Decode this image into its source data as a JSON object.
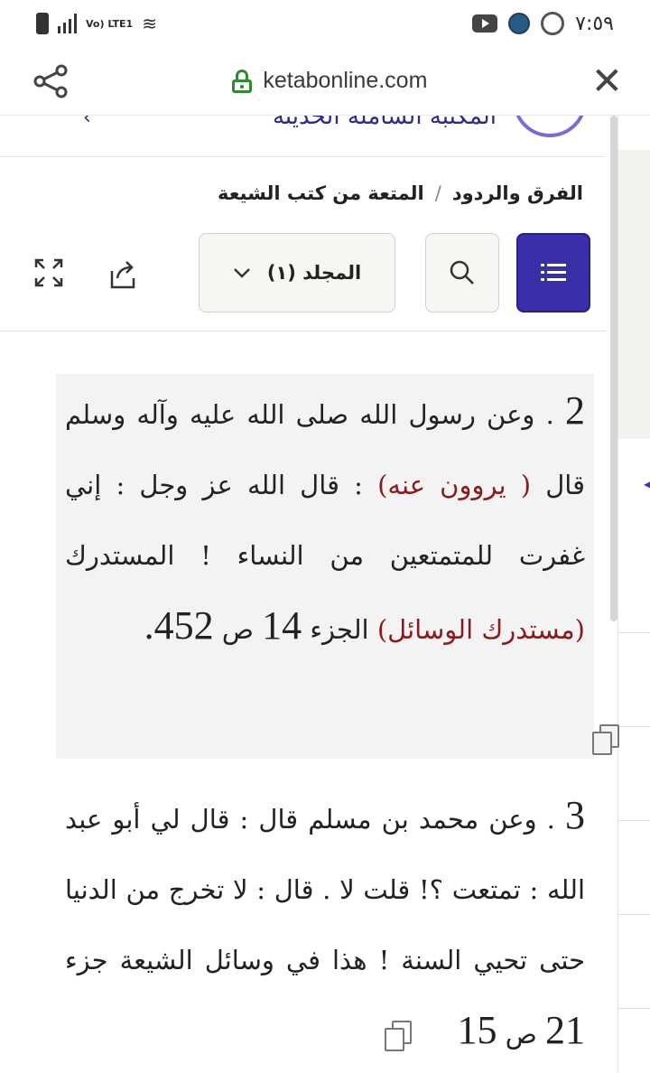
{
  "status_bar": {
    "time": "٧:٥٩",
    "network": "Vo) LTE1"
  },
  "browser": {
    "url": "ketabonline.com",
    "close_glyph": "✕"
  },
  "site_header": {
    "logo_text": "المكتبة الشاملة الحديثة"
  },
  "breadcrumb": {
    "items": [
      "الفرق والردود",
      "المتعة من كتب الشيعة"
    ],
    "separator": "/"
  },
  "toolbar": {
    "menu_icon": "list-icon",
    "search_icon": "search-icon",
    "volume_label": "المجلد (١)",
    "share_icon": "share-icon",
    "expand_icon": "expand-icon"
  },
  "paragraphs": [
    {
      "number": "2",
      "text_a": " . وعن رسول الله صلى الله عليه وآله وسلم قال ",
      "quote": "( يروون عنه)",
      "text_b": " : قال الله عز وجل : إني غفرت للمتمتعين من النساء ! المستدرك ",
      "source": "(مستدرك الوسائل)",
      "text_c": " الجزء ",
      "part": "14",
      "text_d": " ص ",
      "page": "452."
    },
    {
      "number": "3",
      "text_a": " . وعن محمد بن مسلم قال : قال لي أبو عبد الله : تمتعت ؟! قلت لا . قال : لا تخرج من الدنيا حتى تحيي السنة ! هذا في وسائل الشيعة جزء ",
      "part": "21",
      "text_b": " ص ",
      "page": "15"
    }
  ]
}
